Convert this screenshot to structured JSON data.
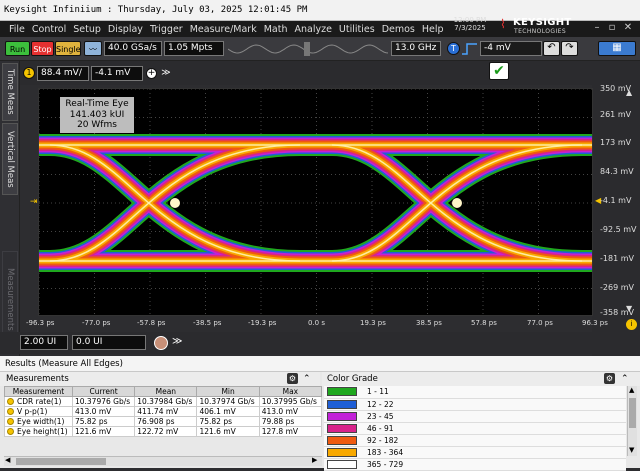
{
  "window": {
    "title": "Keysight Infiniium : Thursday, July 03, 2025 12:01:45 PM"
  },
  "menu": [
    "File",
    "Control",
    "Setup",
    "Display",
    "Trigger",
    "Measure/Mark",
    "Math",
    "Analyze",
    "Utilities",
    "Demos",
    "Help"
  ],
  "clock": {
    "time": "12:00 PM",
    "date": "7/3/2025"
  },
  "brand": {
    "name": "KEYSIGHT",
    "sub": "TECHNOLOGIES"
  },
  "toolbar": {
    "run": "Run",
    "stop": "Stop",
    "single": "Single",
    "sample_rate": "40.0 GSa/s",
    "memory_depth": "1.05 Mpts",
    "bandwidth": "13.0 GHz",
    "trigger_level": "-4 mV",
    "trigger_badge": "T"
  },
  "channel": {
    "badge": "1",
    "scale": "88.4 mV/",
    "offset": "-4.1 mV"
  },
  "side_tabs": {
    "time_meas": "Time Meas",
    "vertical_meas": "Vertical Meas",
    "measurements": "Measurements"
  },
  "eye_info": {
    "line1": "Real-Time Eye",
    "line2": "141.403 kUI",
    "line3": "20 Wfms"
  },
  "y_axis": [
    "350 mV",
    "261 mV",
    "173 mV",
    "84.3 mV",
    "-4.1 mV",
    "-92.5 mV",
    "-181 mV",
    "-269 mV",
    "-358 mV"
  ],
  "x_axis": [
    "-96.3 ps",
    "-77.0 ps",
    "-57.8 ps",
    "-38.5 ps",
    "-19.3 ps",
    "0.0 s",
    "19.3 ps",
    "38.5 ps",
    "57.8 ps",
    "77.0 ps",
    "96.3 ps"
  ],
  "ui_row": {
    "span": "2.00 UI",
    "offset": "0.0 UI"
  },
  "results": {
    "header": "Results  (Measure All Edges)",
    "measurements_label": "Measurements",
    "color_grade_label": "Color Grade",
    "columns": [
      "Measurement",
      "Current",
      "Mean",
      "Min",
      "Max"
    ],
    "rows": [
      [
        "CDR rate(1)",
        "10.37976 Gb/s",
        "10.37984 Gb/s",
        "10.37974 Gb/s",
        "10.37995 Gb/s"
      ],
      [
        "V p-p(1)",
        "413.0 mV",
        "411.74 mV",
        "406.1 mV",
        "413.0 mV"
      ],
      [
        "Eye width(1)",
        "75.82 ps",
        "76.908 ps",
        "75.82 ps",
        "79.88 ps"
      ],
      [
        "Eye height(1)",
        "121.6 mV",
        "122.72 mV",
        "121.6 mV",
        "127.8 mV"
      ]
    ],
    "color_grade": [
      {
        "range": "1 - 11",
        "color": "#1fa81f"
      },
      {
        "range": "12 - 22",
        "color": "#1f5fd6"
      },
      {
        "range": "23 - 45",
        "color": "#c221d8"
      },
      {
        "range": "46 - 91",
        "color": "#d8228a"
      },
      {
        "range": "92 - 182",
        "color": "#ef5a10"
      },
      {
        "range": "183 - 364",
        "color": "#f8a900"
      },
      {
        "range": "365 - 729",
        "color": "#ffffff"
      }
    ]
  }
}
